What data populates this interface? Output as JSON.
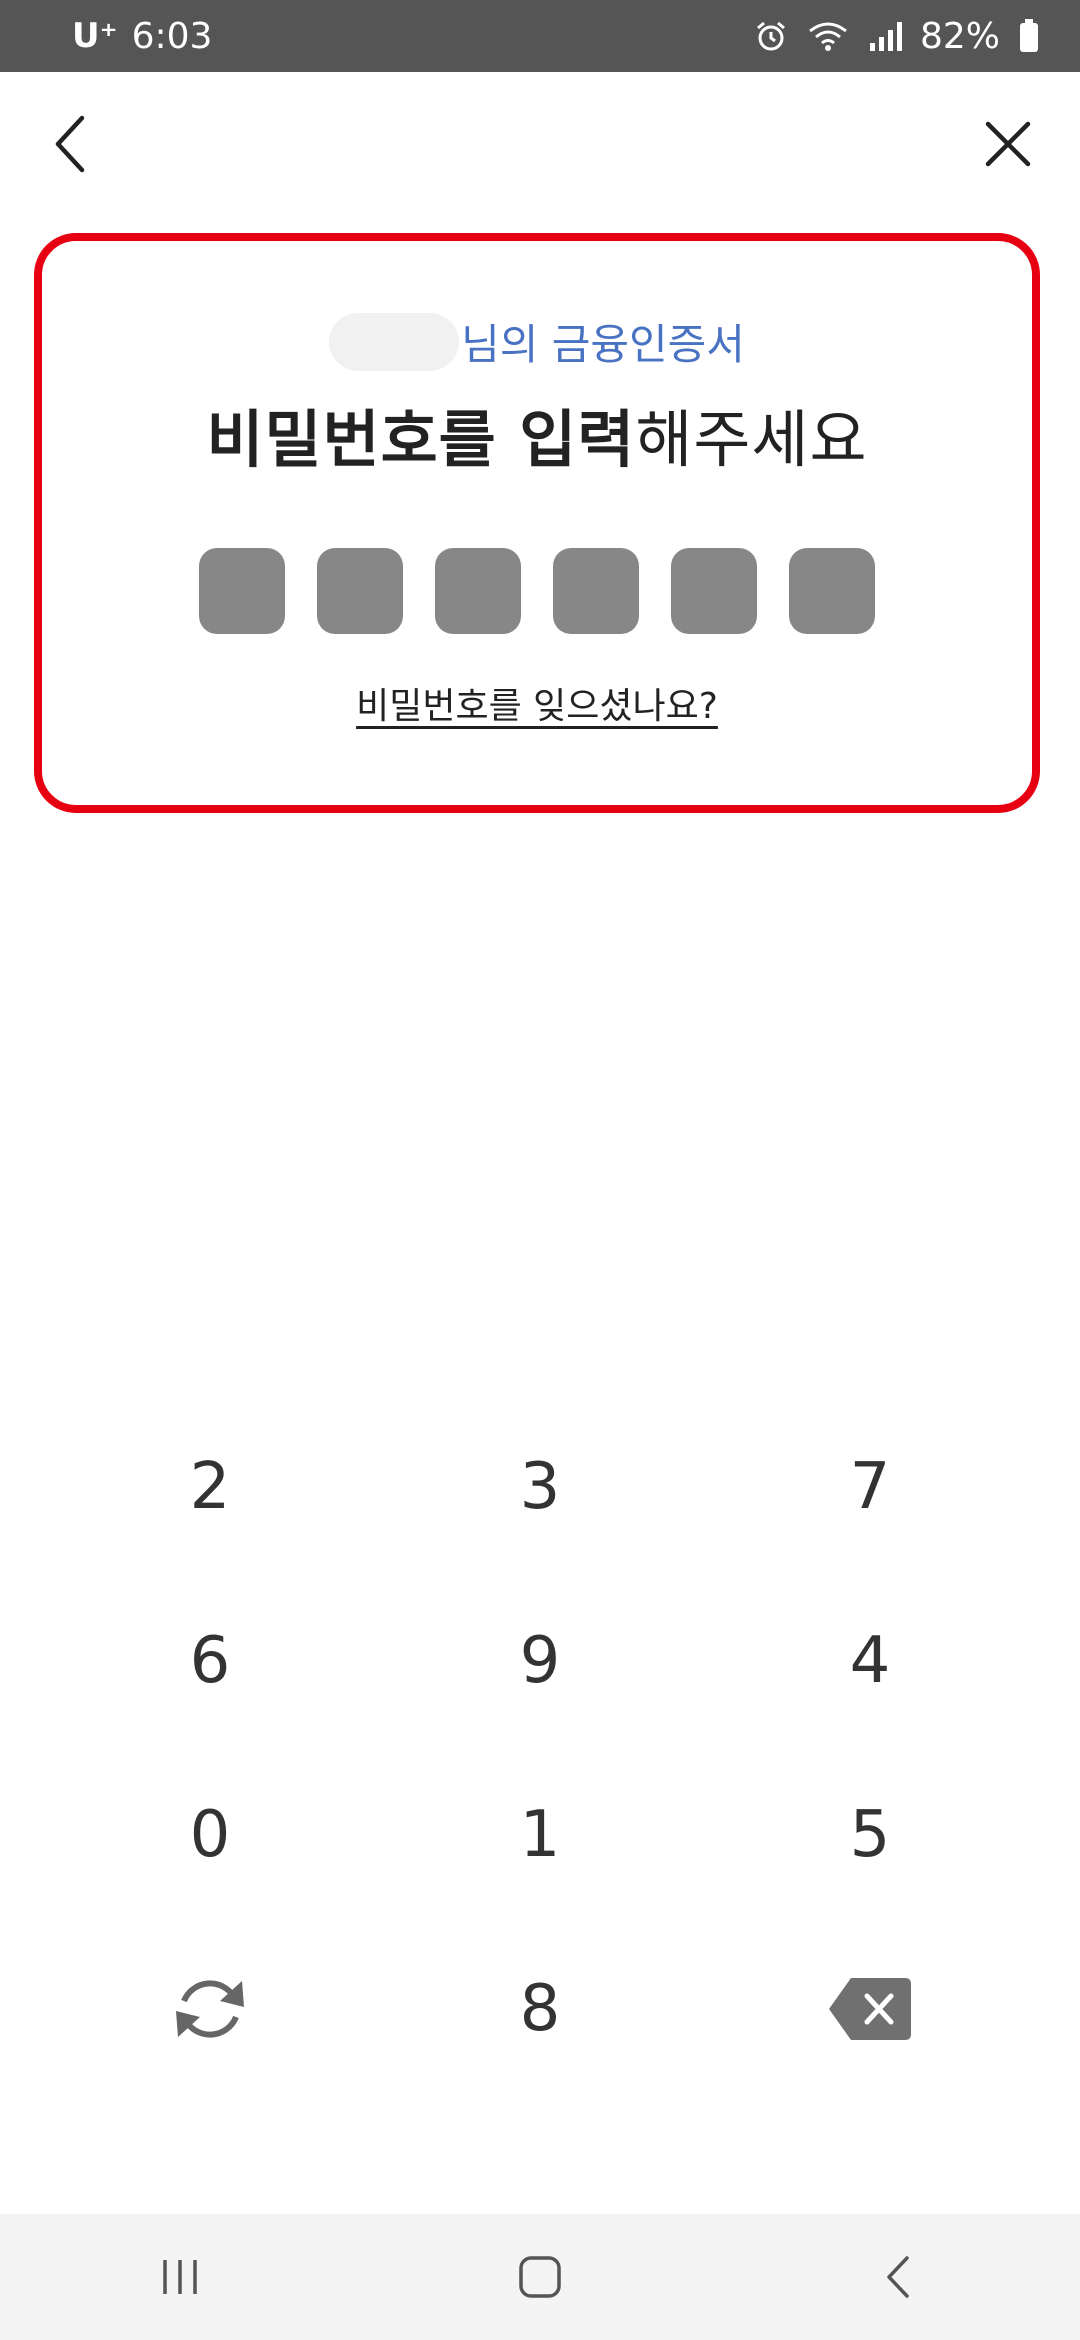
{
  "status_bar": {
    "carrier": "U⁺",
    "time": "6:03",
    "battery": "82%",
    "icons": [
      "alarm-icon",
      "wifi-icon",
      "signal-icon",
      "battery-icon"
    ]
  },
  "header": {
    "back_icon": "chevron-left-icon",
    "close_icon": "close-icon"
  },
  "card": {
    "cert_suffix": "님의 금융인증서",
    "title_bold": "비밀번호를 입력",
    "title_normal": "해주세요",
    "pin_length": 6,
    "forgot_link": "비밀번호를 잊으셨나요?",
    "highlight_color": "#e60012",
    "accent_color": "#4a72c2"
  },
  "keypad": {
    "keys": [
      "2",
      "3",
      "7",
      "6",
      "9",
      "4",
      "0",
      "1",
      "5",
      "refresh",
      "8",
      "backspace"
    ]
  },
  "nav_bar": {
    "buttons": [
      "recent-apps-icon",
      "home-icon",
      "back-icon"
    ]
  }
}
